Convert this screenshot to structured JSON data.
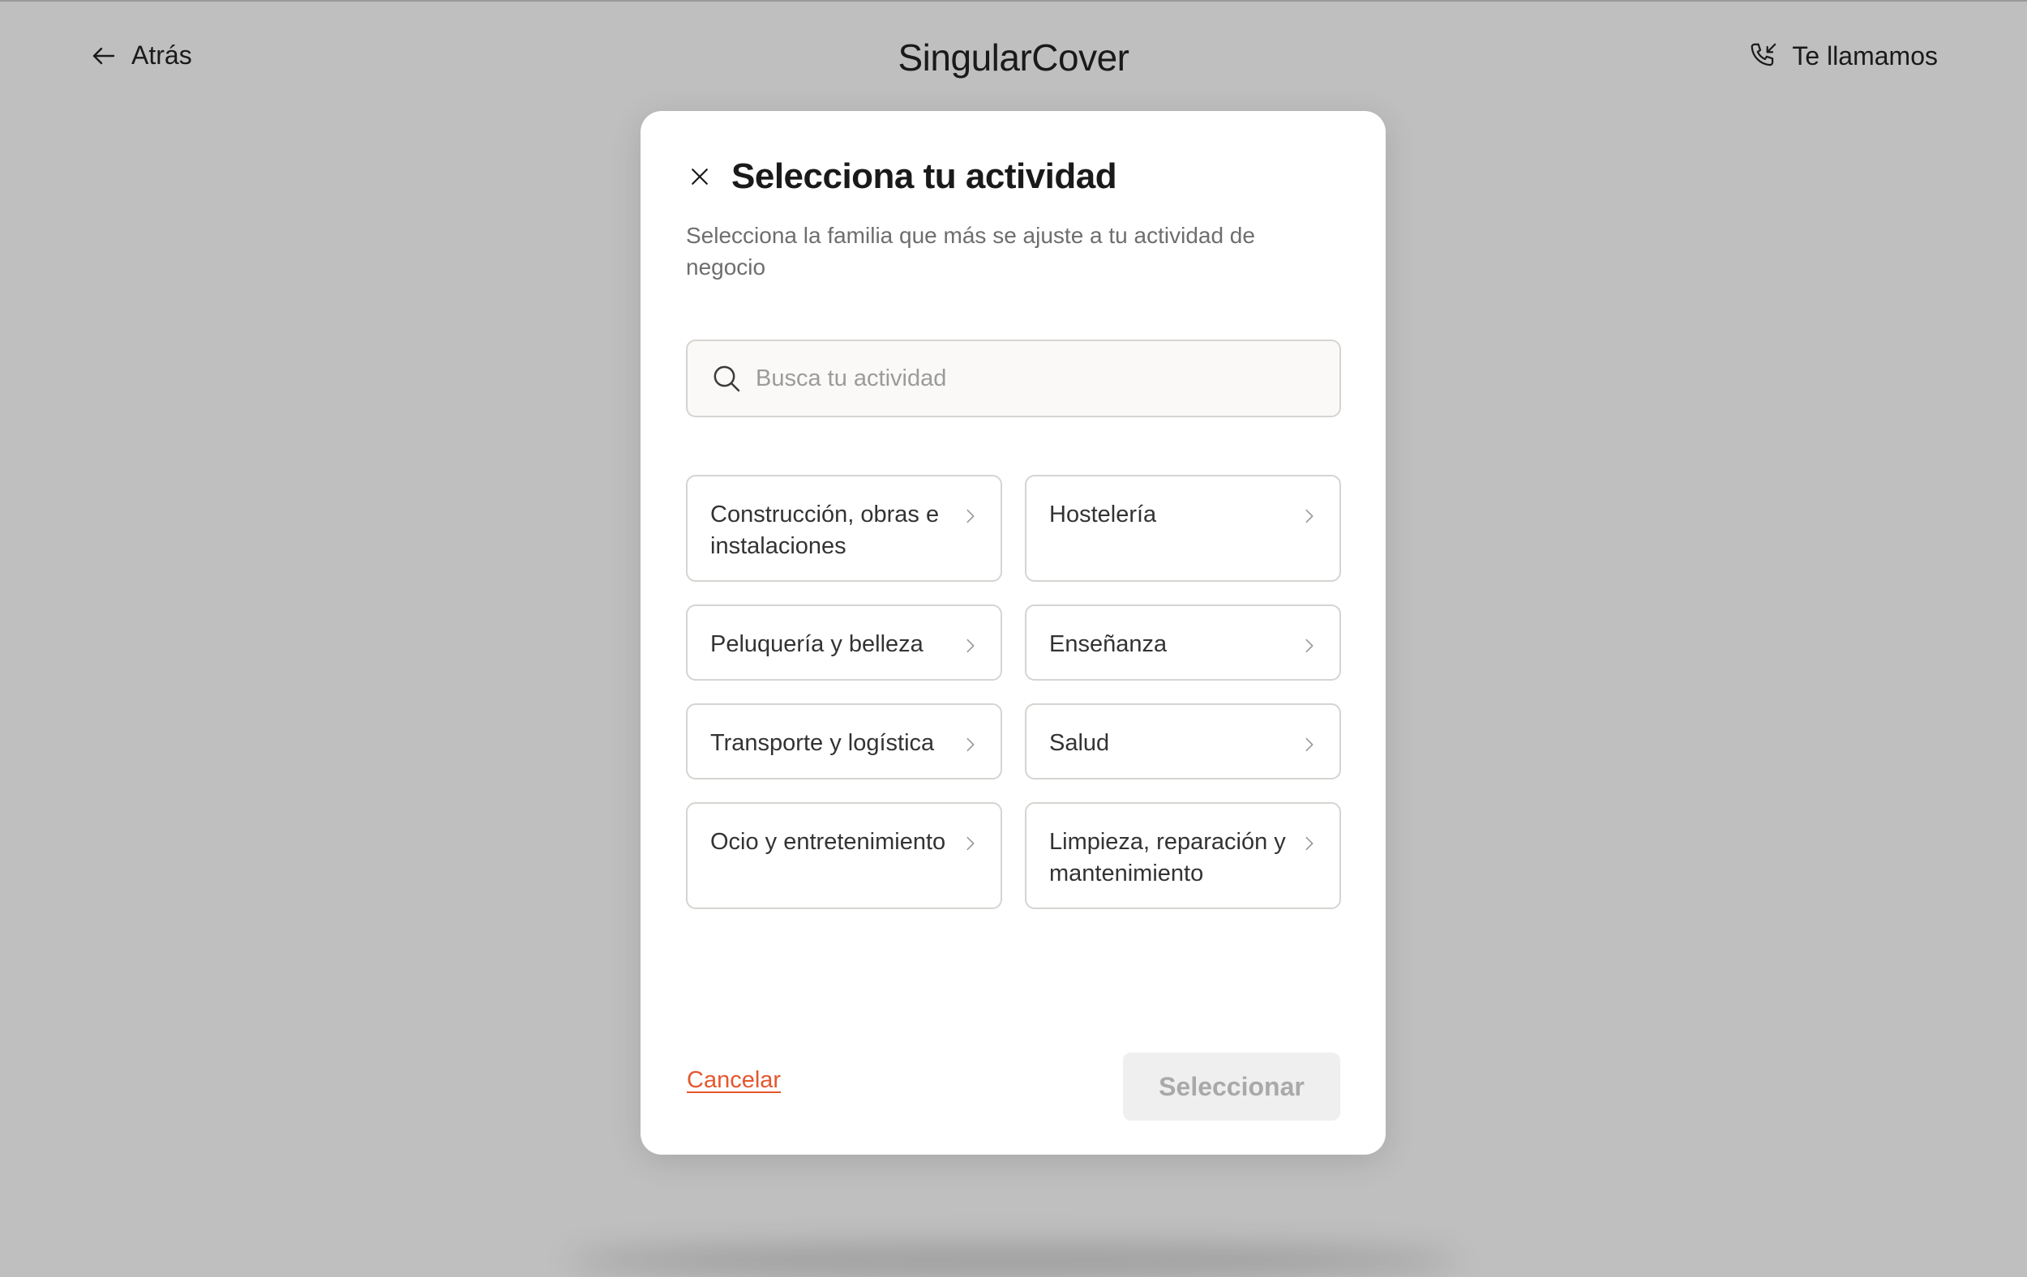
{
  "header": {
    "back_label": "Atrás",
    "brand": "SingularCover",
    "call_label": "Te llamamos"
  },
  "modal": {
    "title": "Selecciona tu actividad",
    "subtitle": "Selecciona la familia que más se ajuste a tu actividad de negocio",
    "search_placeholder": "Busca tu actividad",
    "search_value": "",
    "activities": [
      "Construcción, obras e instalaciones",
      "Hostelería",
      "Peluquería y belleza",
      "Enseñanza",
      "Transporte y logística",
      "Salud",
      "Ocio y entretenimiento",
      "Limpieza, reparación y mantenimiento"
    ],
    "cancel_label": "Cancelar",
    "select_label": "Seleccionar"
  },
  "colors": {
    "backdrop": "#bfbfbf",
    "accent": "#e4572e",
    "disabled_bg": "#efefef",
    "disabled_text": "#a9a9a9"
  },
  "icons": {
    "back": "arrow-left-icon",
    "call": "phone-incoming-icon",
    "close": "close-icon",
    "search": "search-icon",
    "chevron": "chevron-right-icon"
  }
}
